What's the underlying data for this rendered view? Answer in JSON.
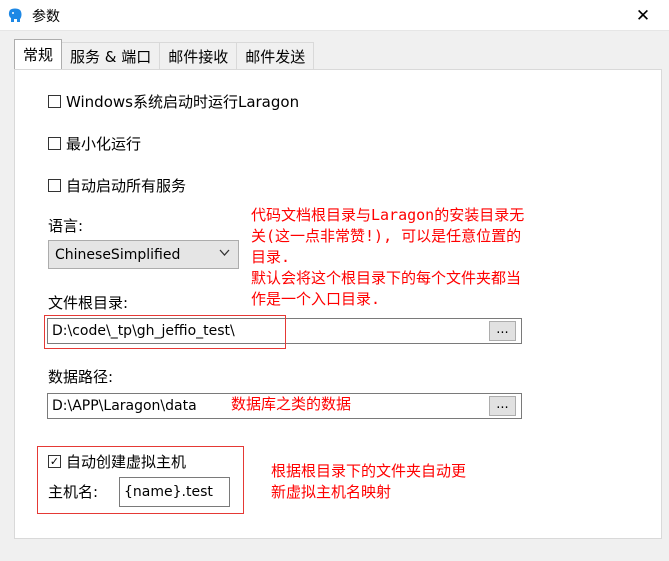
{
  "window": {
    "title": "参数",
    "close_glyph": "✕"
  },
  "tabs": [
    {
      "label": "常规",
      "active": true
    },
    {
      "label": "服务 & 端口",
      "active": false
    },
    {
      "label": "邮件接收",
      "active": false
    },
    {
      "label": "邮件发送",
      "active": false
    }
  ],
  "general": {
    "cb_windows_startup": {
      "label": "Windows系统启动时运行Laragon",
      "checked": false
    },
    "cb_minimized": {
      "label": "最小化运行",
      "checked": false
    },
    "cb_autostart_services": {
      "label": "自动启动所有服务",
      "checked": false
    },
    "language": {
      "label": "语言:",
      "value": "ChineseSimplified"
    },
    "document_root": {
      "label": "文件根目录:",
      "value": "D:\\code\\_tp\\gh_jeffio_test\\",
      "browse_label": "..."
    },
    "data_path": {
      "label": "数据路径:",
      "value": "D:\\APP\\Laragon\\data",
      "browse_label": "..."
    },
    "cb_auto_vhost": {
      "label": "自动创建虚拟主机",
      "checked": true,
      "check_glyph": "✓"
    },
    "hostname": {
      "label": "主机名:",
      "value": "{name}.test"
    }
  },
  "annotations": {
    "doc_root_note": [
      "代码文档根目录与Laragon的安装目录无",
      "关(这一点非常赞!), 可以是任意位置的",
      "目录.",
      "默认会将这个根目录下的每个文件夹都当",
      "作是一个入口目录."
    ],
    "data_note": "数据库之类的数据",
    "vhost_note": [
      "根据根目录下的文件夹自动更",
      "新虚拟主机名映射"
    ]
  },
  "colors": {
    "annotation": "#ff0000",
    "box": "#e53935",
    "app_icon": "#1e88e5"
  },
  "icons": {
    "app": "elephant-icon",
    "dropdown": "chevron-down-icon"
  }
}
